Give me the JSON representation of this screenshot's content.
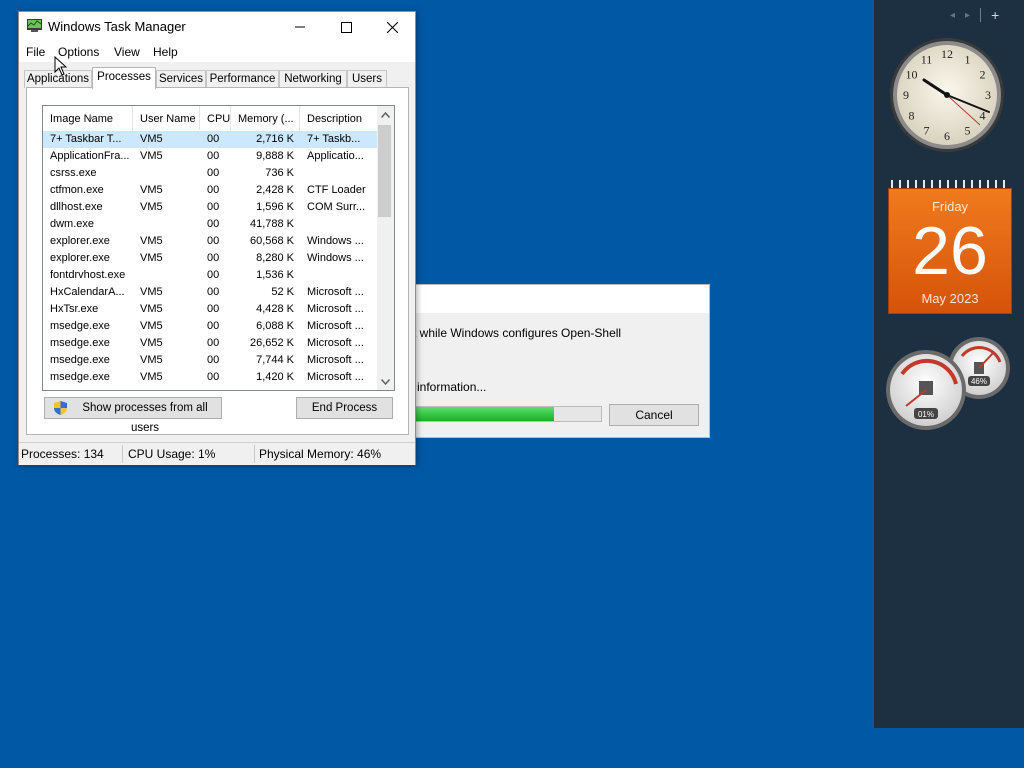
{
  "sidebar": {
    "nav_prev": "◂",
    "nav_next": "▸",
    "add": "+",
    "calendar": {
      "day": "Friday",
      "date": "26",
      "month": "May 2023"
    },
    "meters": {
      "cpu": "01%",
      "memory": "46%"
    },
    "clock_numbers": [
      "12",
      "1",
      "2",
      "3",
      "4",
      "5",
      "6",
      "7",
      "8",
      "9",
      "10",
      "11"
    ]
  },
  "setup_dialog": {
    "message": "t while Windows configures Open-Shell",
    "info": "information...",
    "progress": 0.75,
    "cancel": "Cancel"
  },
  "task_manager": {
    "title": "Windows Task Manager",
    "menu": [
      "File",
      "Options",
      "View",
      "Help"
    ],
    "tabs": [
      "Applications",
      "Processes",
      "Services",
      "Performance",
      "Networking",
      "Users"
    ],
    "active_tab": "Processes",
    "columns": [
      "Image Name",
      "User Name",
      "CPU",
      "Memory (...",
      "Description"
    ],
    "rows": [
      {
        "name": "7+ Taskbar T...",
        "user": "VM5",
        "cpu": "00",
        "mem": "2,716 K",
        "desc": "7+ Taskb..."
      },
      {
        "name": "ApplicationFra...",
        "user": "VM5",
        "cpu": "00",
        "mem": "9,888 K",
        "desc": "Applicatio..."
      },
      {
        "name": "csrss.exe",
        "user": "",
        "cpu": "00",
        "mem": "736 K",
        "desc": ""
      },
      {
        "name": "ctfmon.exe",
        "user": "VM5",
        "cpu": "00",
        "mem": "2,428 K",
        "desc": "CTF Loader"
      },
      {
        "name": "dllhost.exe",
        "user": "VM5",
        "cpu": "00",
        "mem": "1,596 K",
        "desc": "COM Surr..."
      },
      {
        "name": "dwm.exe",
        "user": "",
        "cpu": "00",
        "mem": "41,788 K",
        "desc": ""
      },
      {
        "name": "explorer.exe",
        "user": "VM5",
        "cpu": "00",
        "mem": "60,568 K",
        "desc": "Windows ..."
      },
      {
        "name": "explorer.exe",
        "user": "VM5",
        "cpu": "00",
        "mem": "8,280 K",
        "desc": "Windows ..."
      },
      {
        "name": "fontdrvhost.exe",
        "user": "",
        "cpu": "00",
        "mem": "1,536 K",
        "desc": ""
      },
      {
        "name": "HxCalendarA...",
        "user": "VM5",
        "cpu": "00",
        "mem": "52 K",
        "desc": "Microsoft ..."
      },
      {
        "name": "HxTsr.exe",
        "user": "VM5",
        "cpu": "00",
        "mem": "4,428 K",
        "desc": "Microsoft ..."
      },
      {
        "name": "msedge.exe",
        "user": "VM5",
        "cpu": "00",
        "mem": "6,088 K",
        "desc": "Microsoft ..."
      },
      {
        "name": "msedge.exe",
        "user": "VM5",
        "cpu": "00",
        "mem": "26,652 K",
        "desc": "Microsoft ..."
      },
      {
        "name": "msedge.exe",
        "user": "VM5",
        "cpu": "00",
        "mem": "7,744 K",
        "desc": "Microsoft ..."
      },
      {
        "name": "msedge.exe",
        "user": "VM5",
        "cpu": "00",
        "mem": "1,420 K",
        "desc": "Microsoft ..."
      }
    ],
    "show_all_button": "Show processes from all users",
    "end_process_button": "End Process",
    "status": {
      "processes": "Processes: 134",
      "cpu": "CPU Usage: 1%",
      "memory": "Physical Memory: 46%"
    }
  },
  "colors": {
    "desktop": "#0158a4",
    "sidebar": "#1d3042",
    "calendar": "#e8661a",
    "selection": "#cce8ff",
    "progress": "#16b02a"
  }
}
